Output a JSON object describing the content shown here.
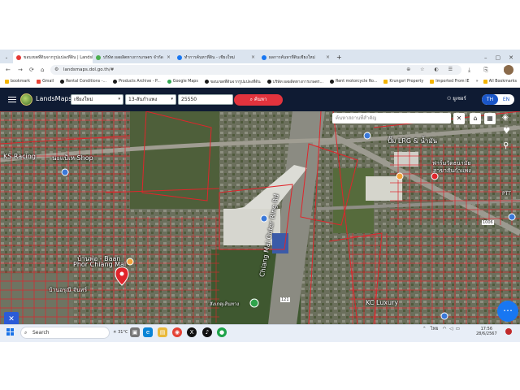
{
  "browser": {
    "tabs": [
      {
        "title": "ขอบเขตที่ดินจากรูปแปลงที่ดิน | LandsMaps",
        "favicon_color": "#e53935",
        "active": true
      },
      {
        "title": "บริษัท ผลผลิตทางการเกษตร จำกัด",
        "favicon_color": "#4caf50",
        "active": false
      },
      {
        "title": "ทำการค้นหาที่ดิน - เชียงใหม่",
        "favicon_color": "#1877f2",
        "active": false
      },
      {
        "title": "ผลการค้นหาที่ดินเชียงใหม่",
        "favicon_color": "#1877f2",
        "active": false
      }
    ],
    "new_tab": "+",
    "url": "landsmaps.dol.go.th/#",
    "nav": {
      "back": "←",
      "forward": "→",
      "reload": "⟳",
      "home": "⌂"
    },
    "bookmarks": [
      {
        "label": "bookmark",
        "color": "#f4b400"
      },
      {
        "label": "Gmail",
        "color": "#ea4335"
      },
      {
        "label": "Rental Conditions -...",
        "color": "#1b1b1b"
      },
      {
        "label": "Products Archive - P...",
        "color": "#1b1b1b"
      },
      {
        "label": "Google Maps",
        "color": "#34a853"
      },
      {
        "label": "ขอบเขตที่ดินจากรูปแปลงที่ดิน",
        "color": "#1b1b1b"
      },
      {
        "label": "บริษัท ผลผลิตทางการเกษตร...",
        "color": "#1b1b1b"
      },
      {
        "label": "Rent motorcycle Ro...",
        "color": "#1b1b1b"
      },
      {
        "label": "Krungsri Property",
        "color": "#f4b400"
      },
      {
        "label": "Imported From IE",
        "color": "#f4b400"
      }
    ],
    "all_bookmarks": "All Bookmarks"
  },
  "app": {
    "brand": "LandsMaps",
    "province": "เชียงใหม่",
    "district": "13-สันกำแพง",
    "parcel_number": "25550",
    "search_label": "ค้นหา",
    "user": "ยูเซอร์",
    "lang_th": "TH",
    "lang_en": "EN",
    "place_search_placeholder": "ค้นหาสถานที่สำคัญ"
  },
  "map": {
    "labels": [
      {
        "text": "KS Racing",
        "id": "lbl-ks"
      },
      {
        "text": "นะแป้เห Shop",
        "id": "lbl-shop"
      },
      {
        "text": "ปั๊ม LRG & น้ำมัน",
        "id": "lbl-pump"
      },
      {
        "text": "ฟาร์มวัดธนามัย",
        "id": "lbl-farm"
      },
      {
        "text": "สาขาสันกำแพง",
        "id": "lbl-branch"
      },
      {
        "text": "Chiang Mai Outer Ring Rd",
        "id": "lbl-road"
      },
      {
        "text": "บ้านพ่อ - Baan",
        "id": "lbl-baan1"
      },
      {
        "text": "Phor Chiang Mai",
        "id": "lbl-baan2"
      },
      {
        "text": "บ้านอรุณี จันทร์",
        "id": "lbl-arunee"
      },
      {
        "text": "KC Luxury",
        "id": "lbl-kc"
      },
      {
        "text": "สังเกตุเส้นทาง",
        "id": "lbl-route"
      },
      {
        "text": "PTT",
        "id": "lbl-ptt"
      },
      {
        "text": "1006",
        "id": "lbl-1006"
      },
      {
        "text": "121",
        "id": "lbl-121"
      }
    ],
    "parcel_color": "#e0252b"
  },
  "taskbar": {
    "search": "Search",
    "weather": "31°C",
    "lang": "ไทย",
    "time": "17:56",
    "date": "28/6/2567"
  }
}
